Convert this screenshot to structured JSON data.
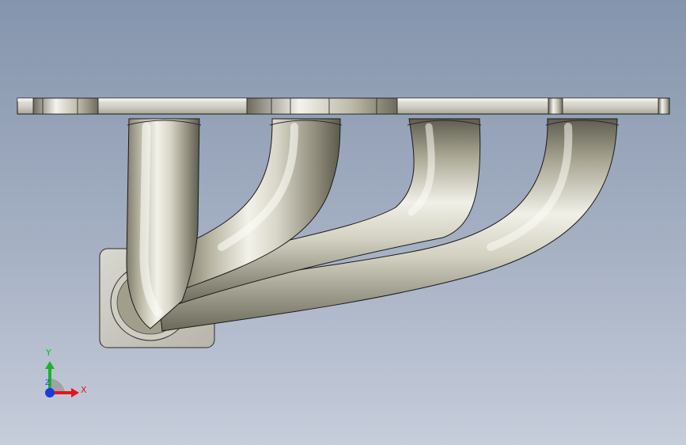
{
  "viewport": {
    "background_top": "#8595ad",
    "background_bottom": "#c6cddb",
    "model": {
      "part_color": "#c9c6b4",
      "edge_color": "#1a1a1a"
    },
    "triad": {
      "x_label": "X",
      "y_label": "Y",
      "z_label": "Z",
      "x_color": "#e8141b",
      "y_color": "#18b42b",
      "z_color": "#1e3ad8"
    }
  }
}
